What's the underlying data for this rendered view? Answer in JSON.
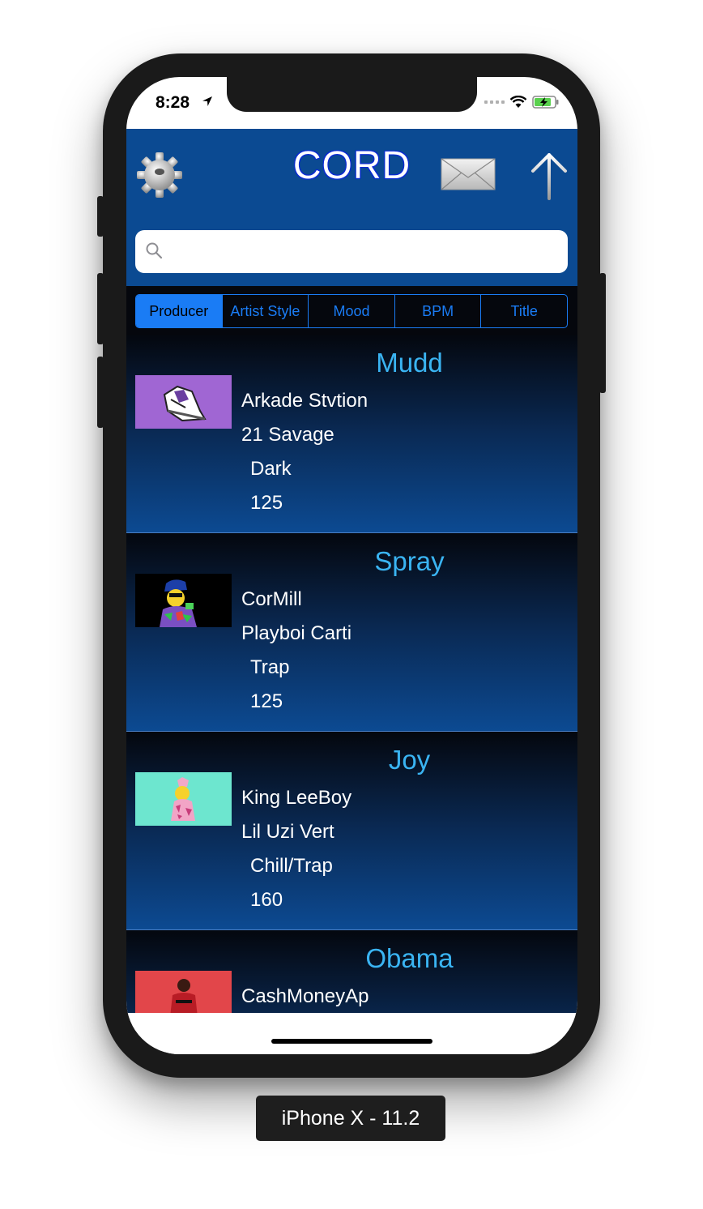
{
  "status": {
    "time": "8:28"
  },
  "nav": {
    "title": "CORD"
  },
  "search": {
    "placeholder": ""
  },
  "segments": [
    "Producer",
    "Artist Style",
    "Mood",
    "BPM",
    "Title"
  ],
  "tracks": [
    {
      "title": "Mudd",
      "producer": "Arkade Stvtion",
      "artist": "21 Savage",
      "mood": "Dark",
      "bpm": "125",
      "thumb_color": "#a066d3"
    },
    {
      "title": "Spray",
      "producer": "CorMill",
      "artist": "Playboi Carti",
      "mood": "Trap",
      "bpm": "125",
      "thumb_color": "#000000"
    },
    {
      "title": "Joy",
      "producer": "King LeeBoy",
      "artist": "Lil Uzi Vert",
      "mood": "Chill/Trap",
      "bpm": "160",
      "thumb_color": "#6de6cf"
    },
    {
      "title": "Obama",
      "producer": "CashMoneyAp",
      "artist": "",
      "mood": "",
      "bpm": "",
      "thumb_color": "#e2464a"
    }
  ],
  "device_caption": "iPhone X - 11.2"
}
